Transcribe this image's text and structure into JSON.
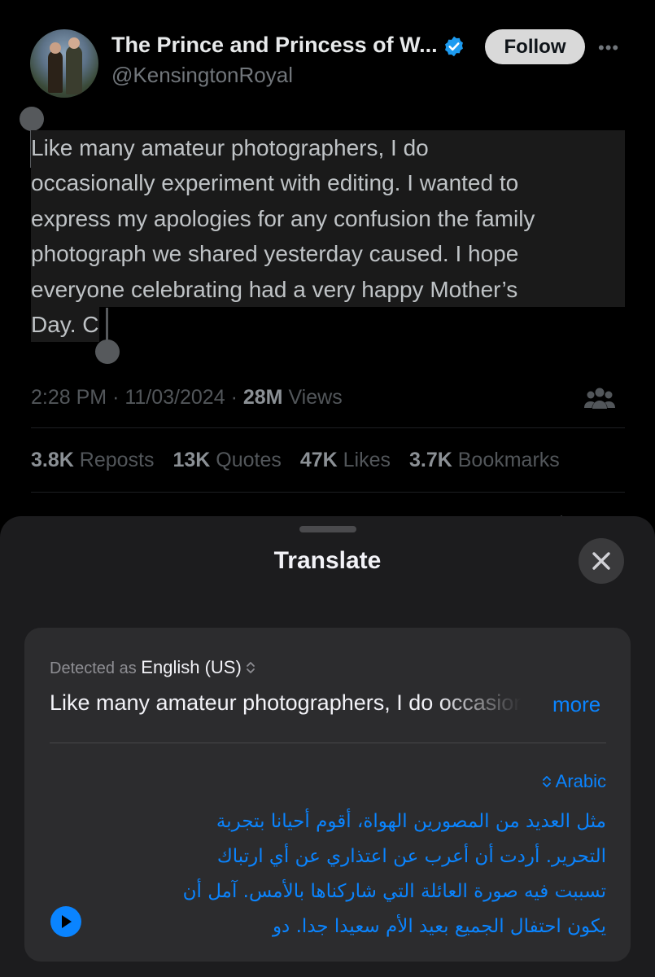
{
  "tweet": {
    "author_name": "The Prince and Princess of W...",
    "handle": "@KensingtonRoyal",
    "follow_label": "Follow",
    "more_icon": "more-dots-icon",
    "text_lines": [
      "Like many amateur photographers, I do",
      "occasionally experiment with editing. I wanted to",
      "express my apologies for any confusion the family",
      "photograph we shared yesterday caused. I hope",
      "everyone celebrating had a very happy Mother’s",
      "Day. C"
    ],
    "time": "2:28 PM",
    "date": "11/03/2024",
    "views_count": "28M",
    "views_label": "Views",
    "stats": {
      "reposts_count": "3.8K",
      "reposts_label": "Reposts",
      "quotes_count": "13K",
      "quotes_label": "Quotes",
      "likes_count": "47K",
      "likes_label": "Likes",
      "bookmarks_count": "3.7K",
      "bookmarks_label": "Bookmarks"
    }
  },
  "translate": {
    "title": "Translate",
    "detected_prefix": "Detected as",
    "detected_language": "English (US)",
    "source_preview": "Like many amateur photographers, I do occasionally",
    "more_label": "more",
    "target_language": "Arabic",
    "translation_lines": [
      "مثل العديد من المصورين الهواة، أقوم أحيانا بتجربة",
      "التحرير. أردت أن أعرب عن اعتذاري عن أي ارتباك",
      "تسببت فيه صورة العائلة التي شاركناها بالأمس. آمل أن",
      "يكون احتفال الجميع بعيد الأم سعيدا جدا. دو"
    ]
  },
  "colors": {
    "background": "#000000",
    "sheet": "#1c1c1e",
    "card": "#2c2c2e",
    "accent_blue": "#0a84ff",
    "verified_blue": "#1d9bf0"
  }
}
